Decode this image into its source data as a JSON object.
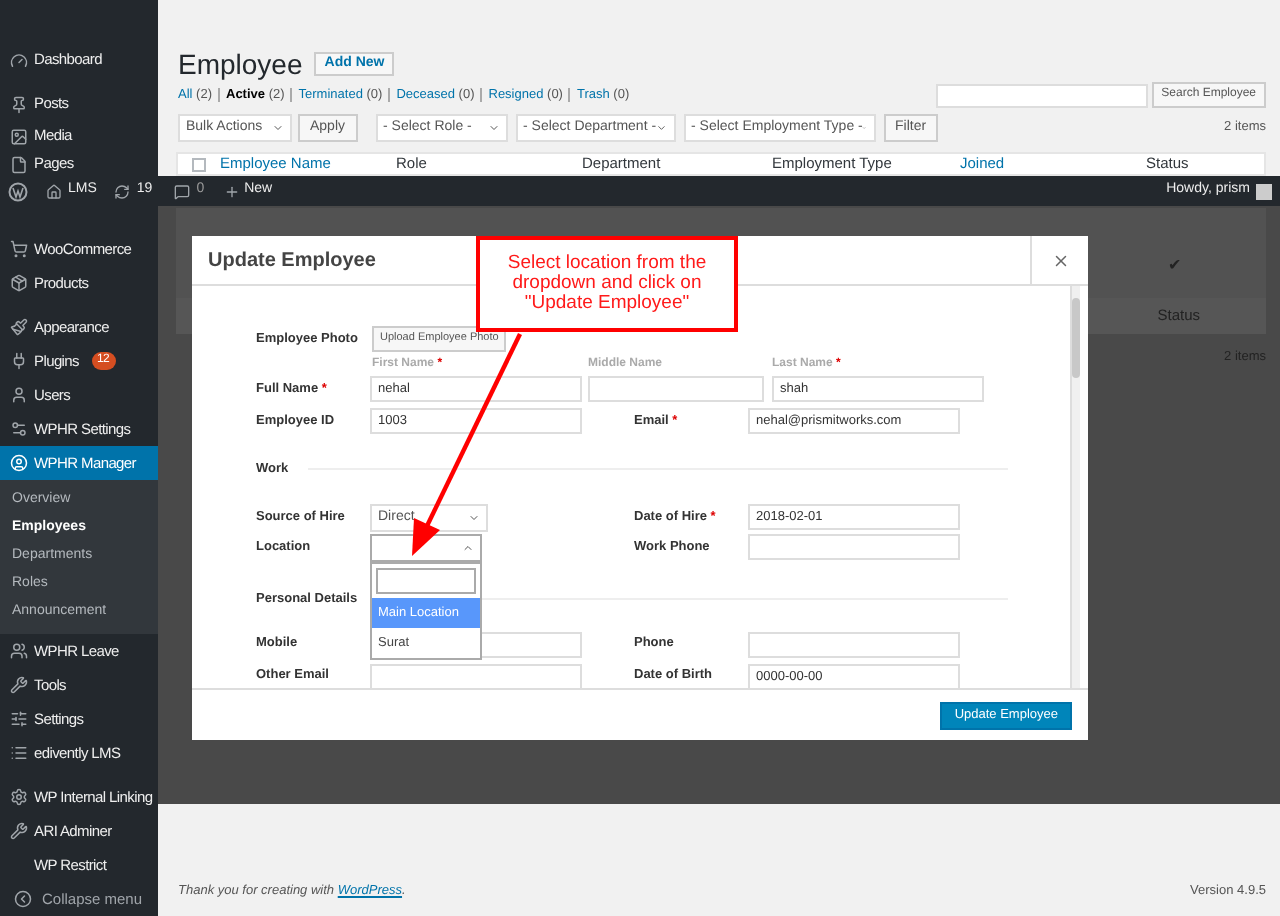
{
  "sidebar": {
    "menu_top": [
      {
        "label": "Dashboard",
        "selected": false
      },
      {
        "label": "Posts",
        "selected": false
      },
      {
        "label": "Media",
        "selected": false
      },
      {
        "label": "Pages",
        "selected": false
      }
    ],
    "menu": [
      {
        "label": "WooCommerce",
        "selected": false
      },
      {
        "label": "Products",
        "selected": false
      },
      {
        "label": "Appearance",
        "selected": false
      },
      {
        "label": "Plugins",
        "badge": "12",
        "selected": false
      },
      {
        "label": "Users",
        "selected": false
      },
      {
        "label": "WPHR Settings",
        "selected": false
      },
      {
        "label": "WPHR Manager",
        "selected": true,
        "children": [
          {
            "label": "Overview",
            "selected": false
          },
          {
            "label": "Employees",
            "selected": true
          },
          {
            "label": "Departments",
            "selected": false
          },
          {
            "label": "Roles",
            "selected": false
          },
          {
            "label": "Announcement",
            "selected": false
          }
        ]
      },
      {
        "label": "WPHR Leave",
        "selected": false
      },
      {
        "label": "Tools",
        "selected": false
      },
      {
        "label": "Settings",
        "selected": false
      },
      {
        "label": "edivently LMS",
        "selected": false
      },
      {
        "label": "WP Internal Linking",
        "selected": false
      },
      {
        "label": "ARI Adminer",
        "selected": false
      },
      {
        "label": "WP Restrict",
        "selected": false
      }
    ],
    "collapse": "Collapse menu"
  },
  "admin_bar": {
    "site": "LMS",
    "updates": "19",
    "comments": "0",
    "new": "New",
    "greeting": "Howdy, prism"
  },
  "page": {
    "title": "Employee",
    "add_new": "Add New",
    "filters": [
      {
        "label": "All",
        "count": "(2)",
        "selected": false
      },
      {
        "label": "Active",
        "count": "(2)",
        "selected": true
      },
      {
        "label": "Terminated",
        "count": "(0)",
        "selected": false
      },
      {
        "label": "Deceased",
        "count": "(0)",
        "selected": false
      },
      {
        "label": "Resigned",
        "count": "(0)",
        "selected": false
      },
      {
        "label": "Trash",
        "count": "(0)",
        "selected": false
      }
    ],
    "search_button": "Search Employee",
    "bulk_actions": "Bulk Actions",
    "apply": "Apply",
    "role_select": "- Select Role -",
    "department_select": "- Select Department -",
    "type_select": "- Select Employment Type -",
    "filter": "Filter",
    "items_count": "2 items",
    "select_all": {
      "checked": false
    },
    "columns": [
      {
        "label": "Employee Name",
        "link": true
      },
      {
        "label": "Role",
        "link": false
      },
      {
        "label": "Department",
        "link": false
      },
      {
        "label": "Employment Type",
        "link": false
      },
      {
        "label": "Joined",
        "link": true
      },
      {
        "label": "Status",
        "link": false
      }
    ],
    "row_status": "✔",
    "footer_status": "Status",
    "items_count_bottom": "2 items"
  },
  "modal": {
    "title": "Update Employee",
    "required_mark": "*",
    "photo": {
      "label": "Employee Photo",
      "button": "Upload Employee Photo"
    },
    "name_labels": [
      {
        "label": "First Name",
        "required": true
      },
      {
        "label": "Middle Name",
        "required": false
      },
      {
        "label": "Last Name",
        "required": true
      }
    ],
    "full_name": {
      "label": "Full Name",
      "required": true,
      "first": "nehal",
      "last": "shah"
    },
    "employee_id": {
      "label": "Employee ID",
      "value": "1003"
    },
    "email": {
      "label": "Email",
      "required": true,
      "value": "nehal@prismitworks.com"
    },
    "work_heading": "Work",
    "source_of_hire": {
      "label": "Source of Hire",
      "value": "Direct"
    },
    "date_of_hire": {
      "label": "Date of Hire",
      "required": true,
      "value": "2018-02-01"
    },
    "location": {
      "label": "Location",
      "expanded": true,
      "options": [
        {
          "label": "Main Location",
          "selected": true
        },
        {
          "label": "Surat",
          "selected": false
        }
      ]
    },
    "work_phone": {
      "label": "Work Phone"
    },
    "personal_heading": "Personal Details",
    "mobile": {
      "label": "Mobile"
    },
    "phone": {
      "label": "Phone"
    },
    "other_email": {
      "label": "Other Email"
    },
    "date_of_birth": {
      "label": "Date of Birth",
      "value": "0000-00-00"
    },
    "submit": "Update Employee"
  },
  "annotation": "Select location from the dropdown and click on \"Update Employee\"",
  "footer": {
    "thanks": "Thank you for creating with ",
    "link": "WordPress",
    "end": ".",
    "version": "Version 4.9.5"
  }
}
